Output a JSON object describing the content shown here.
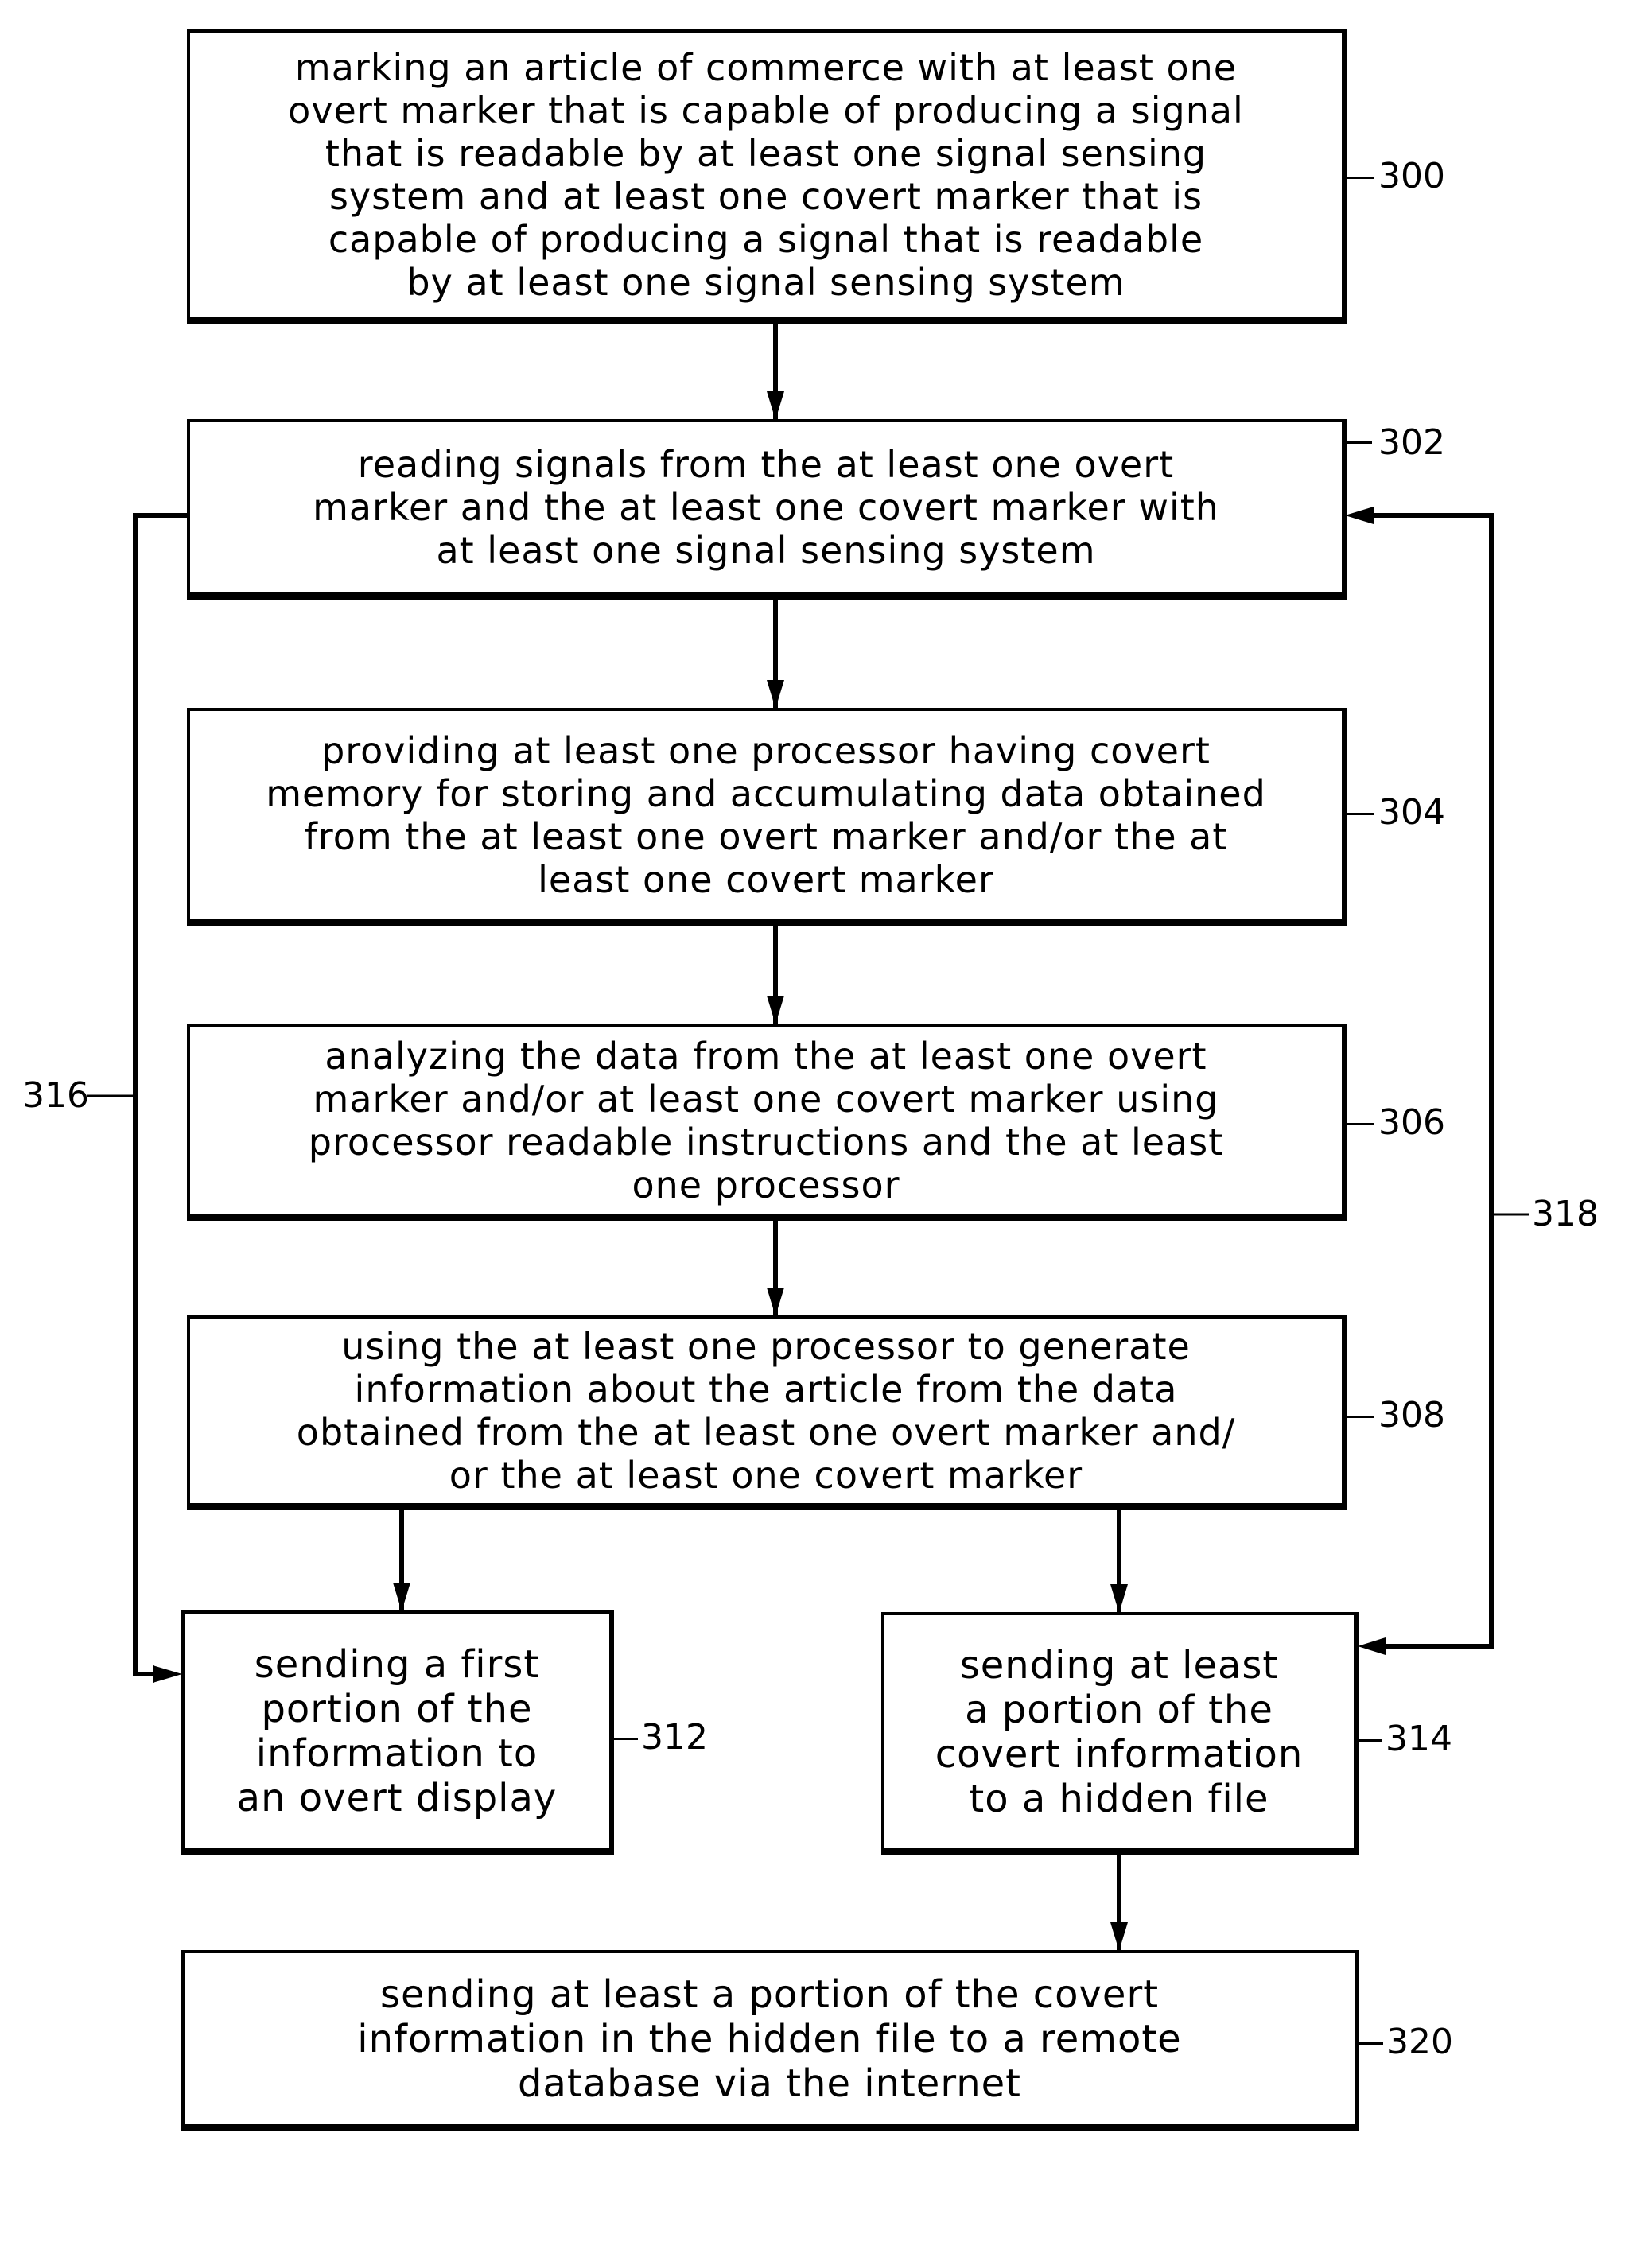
{
  "diagram": {
    "type": "flowchart",
    "steps": [
      {
        "id": "300",
        "ref": "300",
        "text": "marking an article of commerce with at least one\novert marker that is capable of producing a signal\nthat is readable by at least one signal sensing\nsystem and at least one covert marker that is\ncapable of producing a signal that is readable\nby at least one signal sensing system"
      },
      {
        "id": "302",
        "ref": "302",
        "text": "reading signals from the at least one overt\nmarker and the at least one covert marker with\nat least one signal sensing system"
      },
      {
        "id": "304",
        "ref": "304",
        "text": "providing at least one processor having covert\nmemory for storing and accumulating data obtained\nfrom the at least one overt marker and/or the at\nleast one covert marker"
      },
      {
        "id": "306",
        "ref": "306",
        "text": "analyzing the data from the at least one overt\nmarker and/or at least one covert marker using\nprocessor readable instructions and the at least\none processor"
      },
      {
        "id": "308",
        "ref": "308",
        "text": "using the at least one processor to generate\ninformation about the article from the data\nobtained from the at least one overt marker and/\nor the at least one covert marker"
      },
      {
        "id": "312",
        "ref": "312",
        "text": "sending a first\nportion of the\ninformation to\nan overt display"
      },
      {
        "id": "314",
        "ref": "314",
        "text": "sending at least\na portion of the\ncovert information\nto a hidden file"
      },
      {
        "id": "320",
        "ref": "320",
        "text": "sending at least a portion of the covert\ninformation in the hidden file to a remote\ndatabase via the internet"
      }
    ],
    "edges": [
      {
        "from": "300",
        "to": "302"
      },
      {
        "from": "302",
        "to": "304"
      },
      {
        "from": "304",
        "to": "306"
      },
      {
        "from": "306",
        "to": "308"
      },
      {
        "from": "308",
        "to": "312"
      },
      {
        "from": "308",
        "to": "314"
      },
      {
        "from": "314",
        "to": "320"
      },
      {
        "from": "302",
        "to": "312",
        "ref": "316"
      },
      {
        "from": "314",
        "to": "302",
        "ref": "318"
      },
      {
        "from": "302",
        "to": "314",
        "ref": "318"
      }
    ],
    "loop_labels": {
      "left": "316",
      "right": "318"
    },
    "colors": {
      "line": "#000000",
      "background": "#ffffff"
    }
  }
}
